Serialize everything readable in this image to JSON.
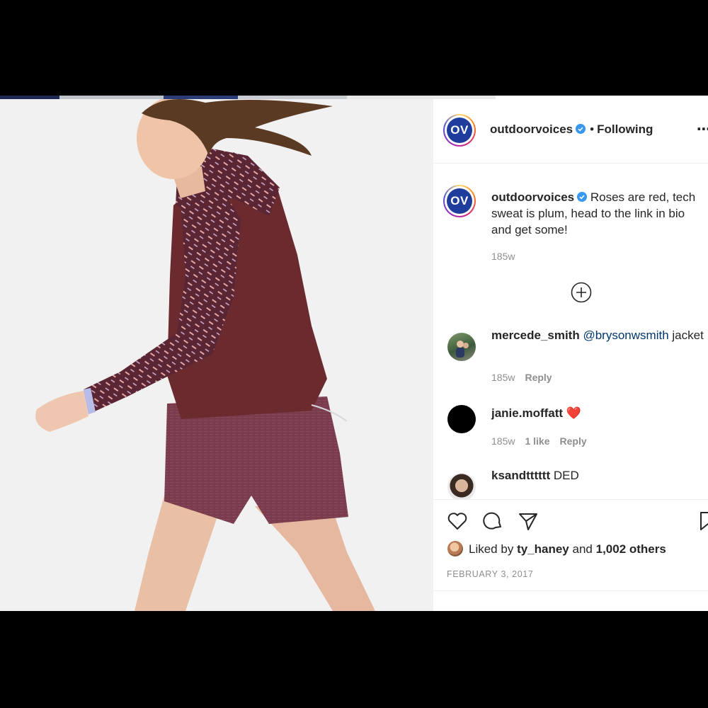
{
  "post": {
    "account": {
      "username": "outdoorvoices",
      "avatar_text": "OV",
      "verified": true,
      "follow_separator": "•",
      "follow_status": "Following",
      "more_icon": "more-dots-icon"
    },
    "caption": {
      "username": "outdoorvoices",
      "text": "Roses are red, tech sweat is plum, head to the link in bio and get some!",
      "timestamp": "185w"
    },
    "load_more_icon": "plus-circle-icon",
    "comments": [
      {
        "username": "mercede_smith",
        "mention": "@brysonwsmith",
        "text": "jacket",
        "timestamp": "185w",
        "likes": "",
        "reply_label": "Reply"
      },
      {
        "username": "janie.moffatt",
        "text": "❤️",
        "timestamp": "185w",
        "likes": "1 like",
        "reply_label": "Reply"
      },
      {
        "username": "ksandtttttt",
        "text": "DED"
      }
    ],
    "actions": {
      "icons": [
        "heart-icon",
        "comment-icon",
        "share-icon",
        "bookmark-icon"
      ]
    },
    "likes": {
      "prefix": "Liked by",
      "user": "ty_haney",
      "joiner": "and",
      "others": "1,002 others"
    },
    "date": "FEBRUARY 3, 2017"
  },
  "colors": {
    "verified": "#3897f0",
    "avatar_brand": "#1f3d9c",
    "jacket": "#6b2a2e",
    "shorts": "#7a3b4c",
    "heart_red": "#ed1c24"
  }
}
